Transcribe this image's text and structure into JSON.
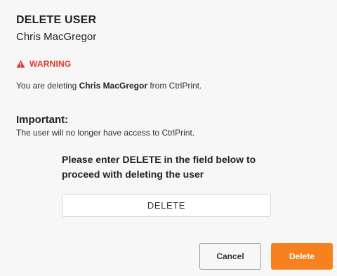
{
  "dialog": {
    "title": "DELETE USER",
    "subtitle": "Chris MacGregor"
  },
  "warning": {
    "icon": "warning-triangle-icon",
    "label": "WARNING",
    "color": "#d93a2b",
    "text_before": "You are deleting ",
    "user_name": "Chris MacGregor",
    "text_after": " from CtrlPrint."
  },
  "important": {
    "heading": "Important:",
    "text": "The user will no longer have access to CtrlPrint."
  },
  "confirm": {
    "prompt": "Please enter DELETE in the field below to proceed with deleting the user",
    "value": "DELETE"
  },
  "buttons": {
    "cancel_label": "Cancel",
    "delete_label": "Delete",
    "delete_color": "#f7811f"
  }
}
